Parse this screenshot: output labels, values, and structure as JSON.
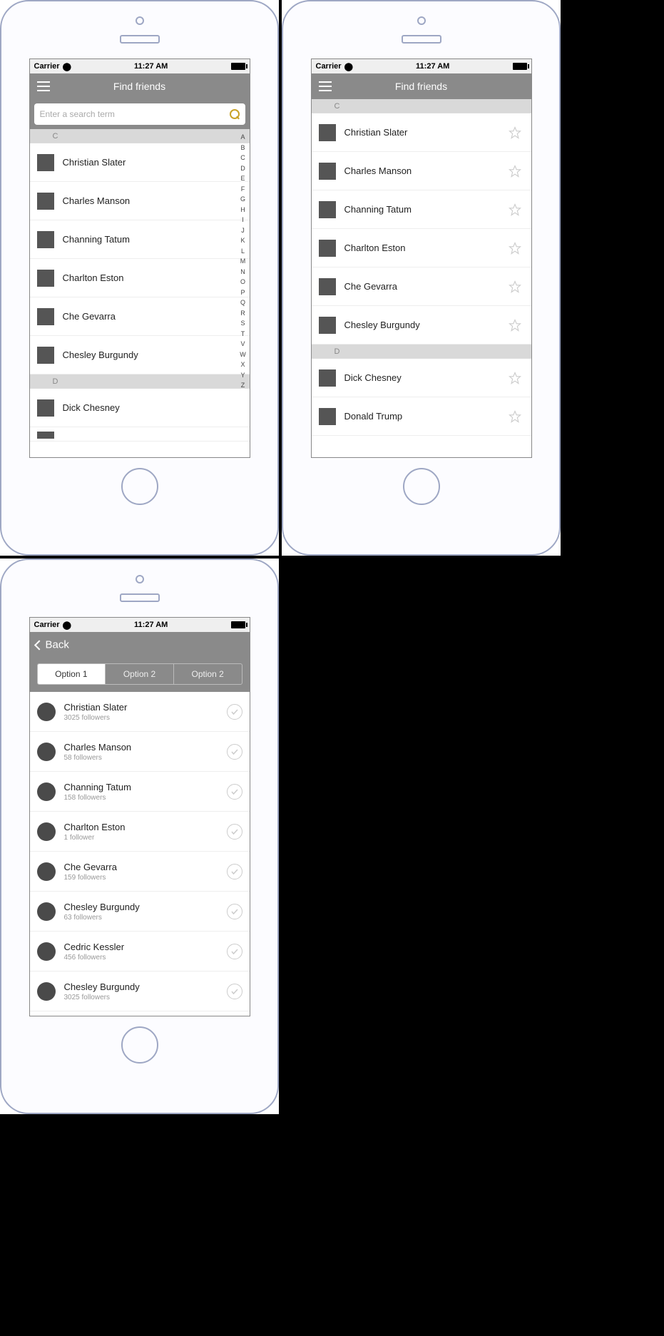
{
  "status": {
    "carrier": "Carrier",
    "time": "11:27 AM"
  },
  "screen1": {
    "title": "Find friends",
    "search_placeholder": "Enter a search term",
    "sections": [
      {
        "letter": "C",
        "rows": [
          "Christian Slater",
          "Charles Manson",
          "Channing Tatum",
          "Charlton Eston",
          "Che Gevarra",
          "Chesley Burgundy"
        ]
      },
      {
        "letter": "D",
        "rows": [
          "Dick Chesney"
        ]
      }
    ],
    "index": [
      "A",
      "B",
      "C",
      "D",
      "E",
      "F",
      "G",
      "H",
      "I",
      "J",
      "K",
      "L",
      "M",
      "N",
      "O",
      "P",
      "Q",
      "R",
      "S",
      "T",
      "V",
      "W",
      "X",
      "Y",
      "Z"
    ]
  },
  "screen2": {
    "title": "Find friends",
    "sections": [
      {
        "letter": "C",
        "rows": [
          "Christian Slater",
          "Charles Manson",
          "Channing Tatum",
          "Charlton Eston",
          "Che Gevarra",
          "Chesley Burgundy"
        ]
      },
      {
        "letter": "D",
        "rows": [
          "Dick Chesney",
          "Donald Trump"
        ]
      }
    ]
  },
  "screen3": {
    "back": "Back",
    "segments": [
      "Option 1",
      "Option 2",
      "Option 2"
    ],
    "rows": [
      {
        "name": "Christian Slater",
        "sub": "3025 followers"
      },
      {
        "name": "Charles Manson",
        "sub": "58 followers"
      },
      {
        "name": "Channing Tatum",
        "sub": "158 followers"
      },
      {
        "name": "Charlton Eston",
        "sub": "1 follower"
      },
      {
        "name": "Che Gevarra",
        "sub": "159 followers"
      },
      {
        "name": "Chesley Burgundy",
        "sub": "63 followers"
      },
      {
        "name": "Cedric Kessler",
        "sub": "456 followers"
      },
      {
        "name": "Chesley Burgundy",
        "sub": "3025 followers"
      }
    ]
  }
}
